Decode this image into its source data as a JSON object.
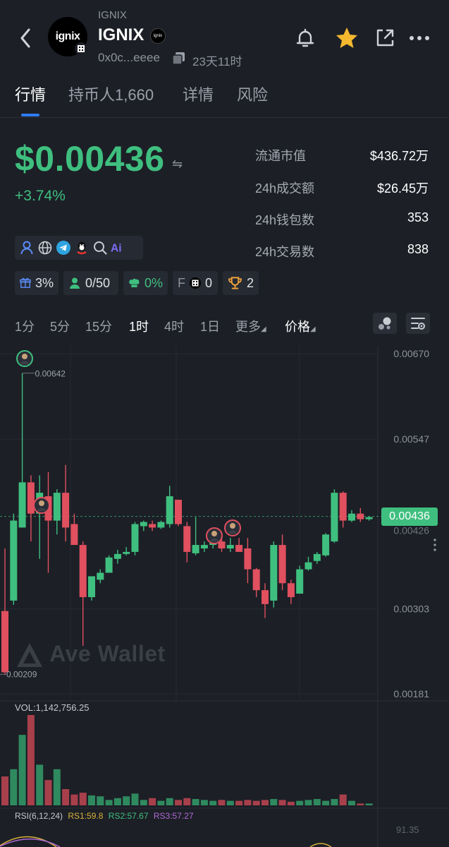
{
  "header": {
    "small_symbol": "IGNIX",
    "symbol": "IGNIX",
    "logo_text": "ignix",
    "address": "0x0c...eeee",
    "age": "23天11时"
  },
  "tabs": [
    {
      "label": "行情",
      "active": true
    },
    {
      "label": "持币人1,660",
      "active": false
    },
    {
      "label": "详情",
      "active": false
    },
    {
      "label": "风险",
      "active": false
    }
  ],
  "price": {
    "value": "$0.00436",
    "swap_symbol": "⇋",
    "change": "+3.74%"
  },
  "stats": [
    {
      "label": "流通市值",
      "value": "$436.72万"
    },
    {
      "label": "24h成交额",
      "value": "$26.45万"
    },
    {
      "label": "24h钱包数",
      "value": "353"
    },
    {
      "label": "24h交易数",
      "value": "838"
    }
  ],
  "social_icons": [
    "user-icon",
    "globe-icon",
    "telegram-icon",
    "qq-icon",
    "search-icon",
    "ai-icon"
  ],
  "chips": [
    {
      "name": "gift-chip",
      "value": "3%"
    },
    {
      "name": "holders-chip",
      "value": "0/50"
    },
    {
      "name": "chef-chip",
      "value": "0%"
    },
    {
      "name": "f-chip",
      "prefix": "F",
      "value": "0"
    },
    {
      "name": "trophy-chip",
      "value": "2"
    }
  ],
  "timeframes": [
    "1分",
    "5分",
    "15分",
    "1时",
    "4时",
    "1日",
    "更多",
    "价格"
  ],
  "active_timeframe": "1时",
  "chart_data": {
    "type": "candlestick",
    "y_axis_ticks": [
      "0.00670",
      "0.00547",
      "0.00303",
      "0.00181"
    ],
    "high_label": "0.00642",
    "low_label": "0.00209",
    "current_price": "0.00436",
    "partially_hidden_label": "0.00426",
    "watermark": "Ave Wallet",
    "colors": {
      "up": "#3fbf7f",
      "down": "#e0505f"
    },
    "candles": [
      {
        "o": 0.003,
        "h": 0.0039,
        "l": 0.00209,
        "c": 0.00212
      },
      {
        "o": 0.00315,
        "h": 0.0044,
        "l": 0.00309,
        "c": 0.0043
      },
      {
        "o": 0.0042,
        "h": 0.00642,
        "l": 0.0042,
        "c": 0.00485
      },
      {
        "o": 0.00485,
        "h": 0.00495,
        "l": 0.004,
        "c": 0.0044
      },
      {
        "o": 0.0044,
        "h": 0.00495,
        "l": 0.00375,
        "c": 0.0047
      },
      {
        "o": 0.00465,
        "h": 0.005,
        "l": 0.00355,
        "c": 0.0043
      },
      {
        "o": 0.0043,
        "h": 0.00475,
        "l": 0.0041,
        "c": 0.0047
      },
      {
        "o": 0.0047,
        "h": 0.0051,
        "l": 0.004,
        "c": 0.0042
      },
      {
        "o": 0.00425,
        "h": 0.0044,
        "l": 0.00395,
        "c": 0.00395
      },
      {
        "o": 0.00395,
        "h": 0.004,
        "l": 0.0025,
        "c": 0.0032
      },
      {
        "o": 0.0032,
        "h": 0.0034,
        "l": 0.00315,
        "c": 0.0035
      },
      {
        "o": 0.00345,
        "h": 0.0036,
        "l": 0.0034,
        "c": 0.00355
      },
      {
        "o": 0.00355,
        "h": 0.0038,
        "l": 0.00355,
        "c": 0.00377
      },
      {
        "o": 0.00375,
        "h": 0.00388,
        "l": 0.00368,
        "c": 0.00382
      },
      {
        "o": 0.00382,
        "h": 0.00392,
        "l": 0.0038,
        "c": 0.00385
      },
      {
        "o": 0.00385,
        "h": 0.00428,
        "l": 0.0038,
        "c": 0.00425
      },
      {
        "o": 0.00422,
        "h": 0.0043,
        "l": 0.00415,
        "c": 0.00428
      },
      {
        "o": 0.00425,
        "h": 0.0043,
        "l": 0.00415,
        "c": 0.0042
      },
      {
        "o": 0.0042,
        "h": 0.0043,
        "l": 0.00418,
        "c": 0.00428
      },
      {
        "o": 0.00425,
        "h": 0.0048,
        "l": 0.0042,
        "c": 0.00465
      },
      {
        "o": 0.0046,
        "h": 0.0046,
        "l": 0.00422,
        "c": 0.00425
      },
      {
        "o": 0.00422,
        "h": 0.00428,
        "l": 0.0037,
        "c": 0.00385
      },
      {
        "o": 0.00383,
        "h": 0.00435,
        "l": 0.0038,
        "c": 0.00395
      },
      {
        "o": 0.0039,
        "h": 0.004,
        "l": 0.00385,
        "c": 0.00395
      },
      {
        "o": 0.00395,
        "h": 0.004,
        "l": 0.0039,
        "c": 0.00398
      },
      {
        "o": 0.004,
        "h": 0.00405,
        "l": 0.00385,
        "c": 0.0039
      },
      {
        "o": 0.0039,
        "h": 0.00405,
        "l": 0.00385,
        "c": 0.00395
      },
      {
        "o": 0.00395,
        "h": 0.00405,
        "l": 0.00385,
        "c": 0.00385
      },
      {
        "o": 0.0039,
        "h": 0.00405,
        "l": 0.0034,
        "c": 0.0036
      },
      {
        "o": 0.0036,
        "h": 0.00362,
        "l": 0.0032,
        "c": 0.0033
      },
      {
        "o": 0.0033,
        "h": 0.0034,
        "l": 0.0029,
        "c": 0.0031
      },
      {
        "o": 0.00315,
        "h": 0.004,
        "l": 0.00305,
        "c": 0.00395
      },
      {
        "o": 0.00395,
        "h": 0.0041,
        "l": 0.0033,
        "c": 0.0034
      },
      {
        "o": 0.0034,
        "h": 0.00345,
        "l": 0.0031,
        "c": 0.0032
      },
      {
        "o": 0.00325,
        "h": 0.00365,
        "l": 0.00325,
        "c": 0.0036
      },
      {
        "o": 0.0036,
        "h": 0.00378,
        "l": 0.00358,
        "c": 0.0037
      },
      {
        "o": 0.00372,
        "h": 0.00385,
        "l": 0.00368,
        "c": 0.00382
      },
      {
        "o": 0.0038,
        "h": 0.00412,
        "l": 0.00378,
        "c": 0.0041
      },
      {
        "o": 0.004,
        "h": 0.00475,
        "l": 0.00398,
        "c": 0.0047
      },
      {
        "o": 0.0047,
        "h": 0.00472,
        "l": 0.0042,
        "c": 0.0043
      },
      {
        "o": 0.0043,
        "h": 0.00445,
        "l": 0.00428,
        "c": 0.0044
      },
      {
        "o": 0.0044,
        "h": 0.00448,
        "l": 0.00428,
        "c": 0.00432
      },
      {
        "o": 0.00432,
        "h": 0.00436,
        "l": 0.0043,
        "c": 0.00435
      }
    ],
    "volume_label": "VOL:1,142,756.25",
    "volumes": [
      0.32,
      0.4,
      0.78,
      1.0,
      0.45,
      0.28,
      0.4,
      0.18,
      0.12,
      0.14,
      0.11,
      0.1,
      0.06,
      0.08,
      0.1,
      0.13,
      0.06,
      0.08,
      0.05,
      0.08,
      0.06,
      0.08,
      0.07,
      0.06,
      0.05,
      0.06,
      0.05,
      0.05,
      0.06,
      0.05,
      0.06,
      0.07,
      0.06,
      0.04,
      0.05,
      0.06,
      0.07,
      0.05,
      0.07,
      0.12,
      0.05,
      0.02,
      0.02
    ],
    "rsi": {
      "label": "RSI(6,12,24)",
      "rs1": "RS1:59.8",
      "rs2": "RS2:57.67",
      "rs3": "RS3:57.27",
      "top_value": "91.35",
      "colors": {
        "rs1": "#d8b23a",
        "rs2": "#3fbf7f",
        "rs3": "#b06ad6"
      }
    }
  }
}
